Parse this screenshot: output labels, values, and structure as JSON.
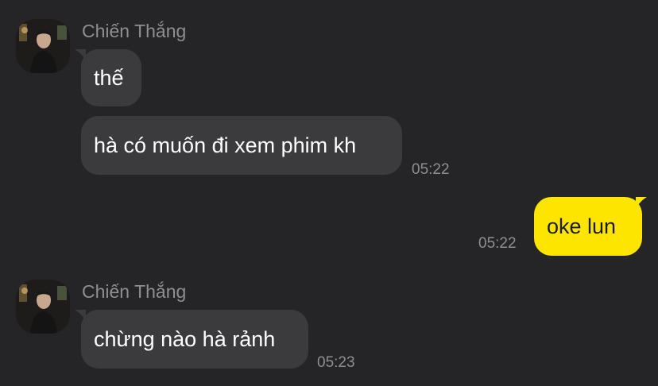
{
  "colors": {
    "background": "#252527",
    "incoming_bubble": "#3b3b3d",
    "outgoing_bubble": "#fee500",
    "meta_text": "#8e8e93"
  },
  "groups": [
    {
      "sender": "Chiến Thắng",
      "messages": [
        {
          "text": "thế"
        },
        {
          "text": "hà có muốn đi xem phim kh",
          "time": "05:22"
        }
      ]
    },
    {
      "outgoing": true,
      "messages": [
        {
          "text": "oke lun",
          "time": "05:22"
        }
      ]
    },
    {
      "sender": "Chiến Thắng",
      "messages": [
        {
          "text": "chừng nào hà rảnh",
          "time": "05:23"
        }
      ]
    }
  ]
}
